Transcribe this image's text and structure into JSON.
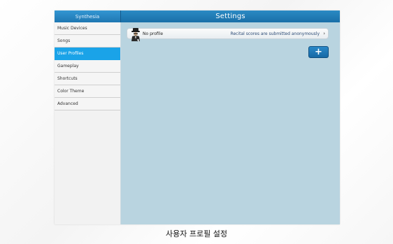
{
  "app": {
    "name": "Synthesia",
    "title": "Settings"
  },
  "sidebar": {
    "items": [
      {
        "label": "Music Devices",
        "active": false
      },
      {
        "label": "Songs",
        "active": false
      },
      {
        "label": "User Profiles",
        "active": true
      },
      {
        "label": "Gameplay",
        "active": false
      },
      {
        "label": "Shortcuts",
        "active": false
      },
      {
        "label": "Color Theme",
        "active": false
      },
      {
        "label": "Advanced",
        "active": false
      }
    ]
  },
  "main": {
    "profile": {
      "name": "No profile",
      "status": "Recital scores are submitted anonymously",
      "chevron": "›",
      "avatar_icon": "mystery-person-icon"
    },
    "add_button": {
      "label": "+",
      "icon": "plus-icon"
    }
  },
  "caption": "사용자 프로필 설정",
  "colors": {
    "accent": "#1aa3e8",
    "header": "#1f77b2",
    "panel": "#b9d4e0"
  }
}
